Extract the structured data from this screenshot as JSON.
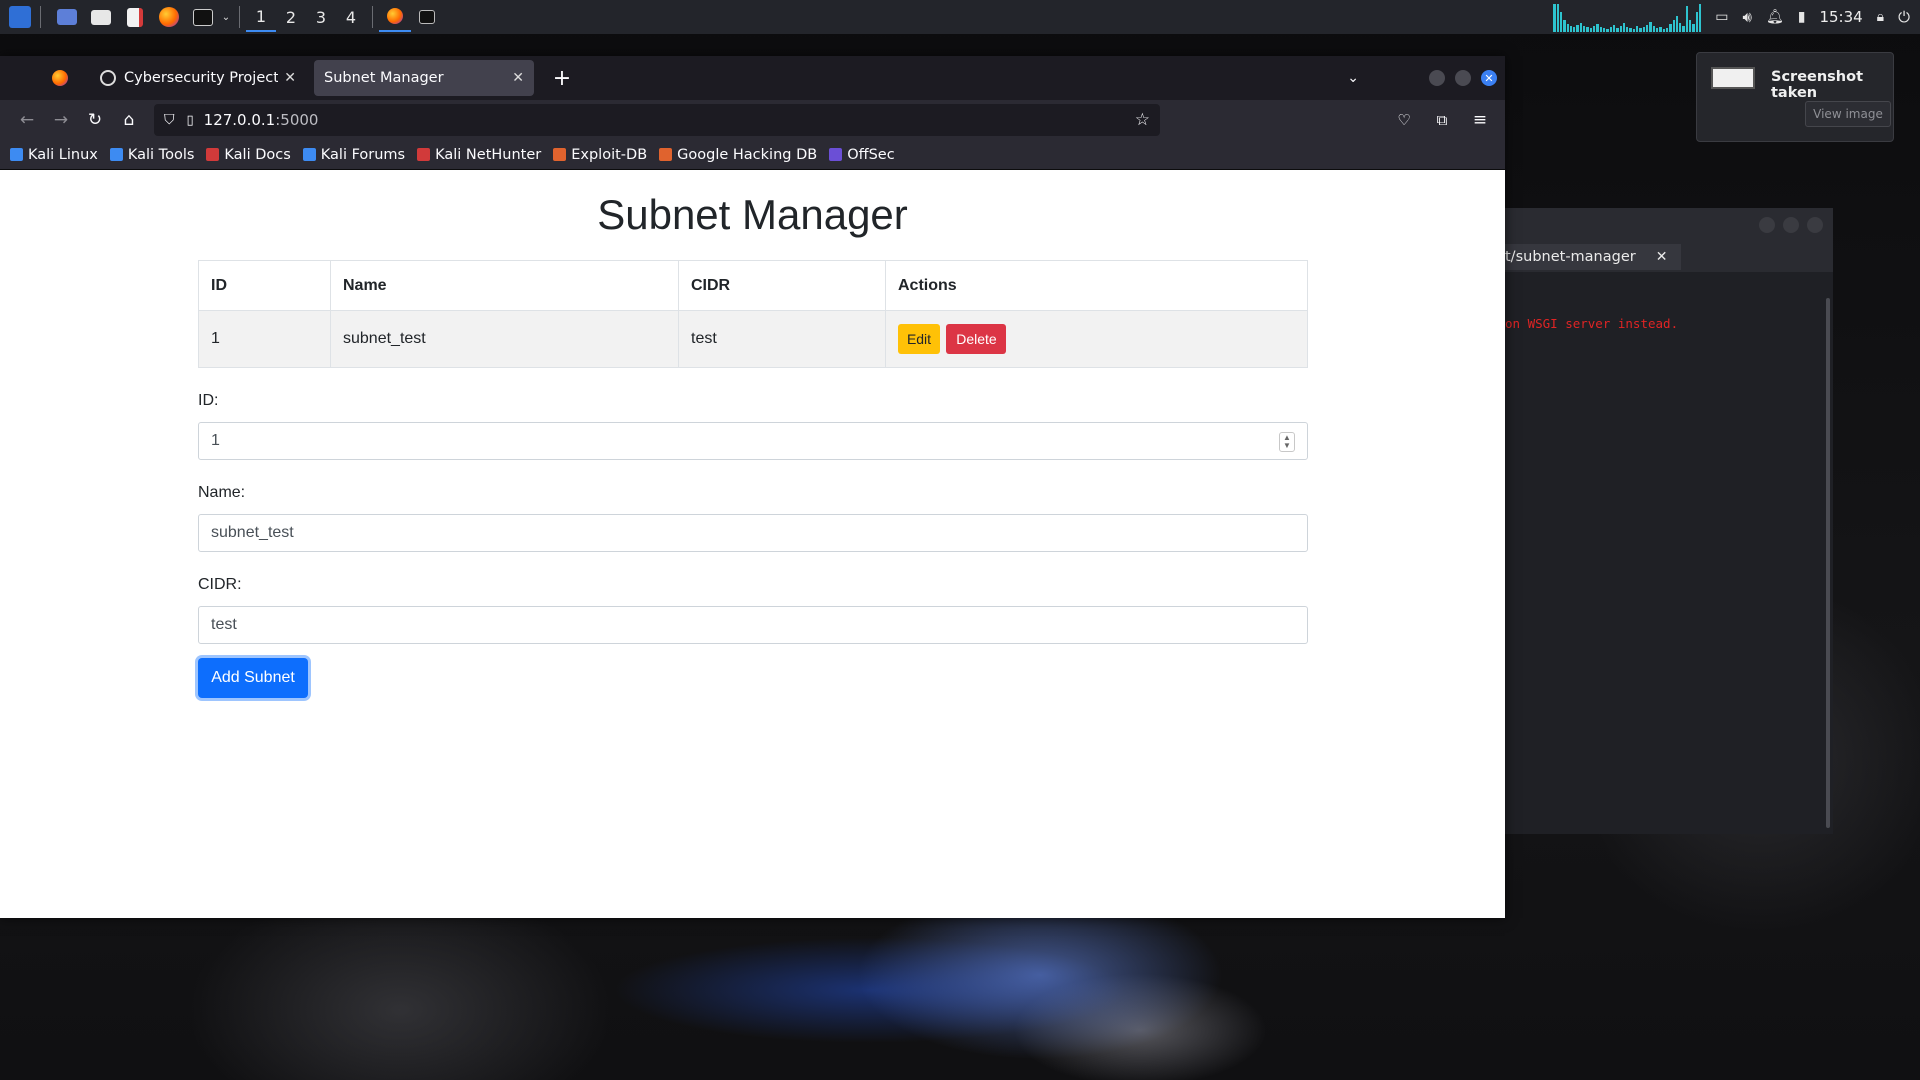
{
  "panel": {
    "workspaces": [
      "1",
      "2",
      "3",
      "4"
    ],
    "active_workspace": "1",
    "clock": "15:34"
  },
  "browser": {
    "tabs": [
      {
        "title": "Cybersecurity Project Ideas",
        "active": false
      },
      {
        "title": "Subnet Manager",
        "active": true
      }
    ],
    "url_host": "127.0.0.1",
    "url_port": ":5000",
    "bookmarks": [
      {
        "label": "Kali Linux",
        "color": "#3d8bf2"
      },
      {
        "label": "Kali Tools",
        "color": "#3d8bf2"
      },
      {
        "label": "Kali Docs",
        "color": "#d13a3a"
      },
      {
        "label": "Kali Forums",
        "color": "#3d8bf2"
      },
      {
        "label": "Kali NetHunter",
        "color": "#d13a3a"
      },
      {
        "label": "Exploit-DB",
        "color": "#e0632e"
      },
      {
        "label": "Google Hacking DB",
        "color": "#e0632e"
      },
      {
        "label": "OffSec",
        "color": "#6b4fd6"
      }
    ]
  },
  "page": {
    "title": "Subnet Manager",
    "table": {
      "headers": [
        "ID",
        "Name",
        "CIDR",
        "Actions"
      ],
      "rows": [
        {
          "id": "1",
          "name": "subnet_test",
          "cidr": "test",
          "edit_label": "Edit",
          "delete_label": "Delete"
        }
      ]
    },
    "form": {
      "id_label": "ID:",
      "id_value": "1",
      "name_label": "Name:",
      "name_value": "subnet_test",
      "cidr_label": "CIDR:",
      "cidr_value": "test",
      "submit_label": "Add Subnet"
    }
  },
  "terminal": {
    "tab_title": "t/subnet-manager",
    "output_line": "on WSGI server instead."
  },
  "notification": {
    "title": "Screenshot taken",
    "button_label": "View image"
  },
  "colors": {
    "accent": "#0d6efd",
    "edit": "#ffc107",
    "delete": "#dc3545",
    "panel": "#23252b"
  }
}
